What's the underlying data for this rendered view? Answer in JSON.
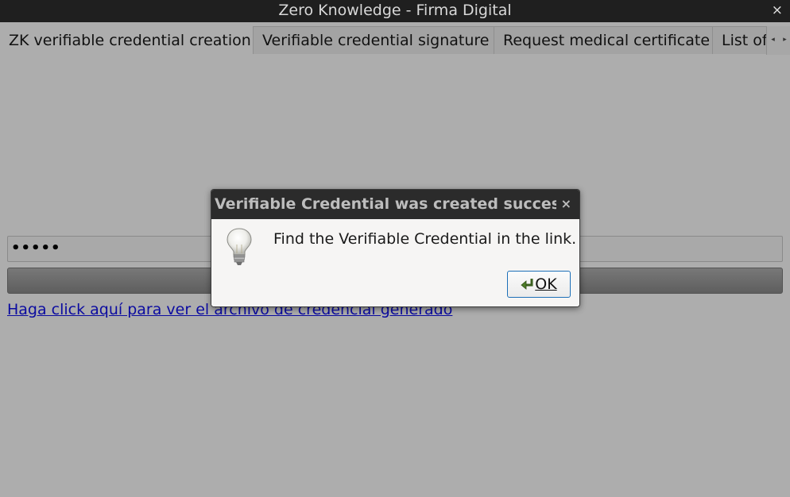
{
  "window": {
    "title": "Zero Knowledge - Firma Digital",
    "close_glyph": "×"
  },
  "tabs": [
    {
      "label": "ZK verifiable credential creation",
      "active": true
    },
    {
      "label": "Verifiable credential signature",
      "active": false
    },
    {
      "label": "Request medical certificate",
      "active": false
    },
    {
      "label": "List of",
      "active": false
    }
  ],
  "tab_scroll": {
    "left_icon": "◂",
    "right_icon": "▸"
  },
  "form": {
    "password_value": "•••••",
    "link_text": "Haga click aquí para ver el archivo de credencial generado",
    "link_color": "#0b0ba0"
  },
  "dialog": {
    "title": "Verifiable Credential was created succesfu…",
    "close_glyph": "×",
    "icon": "lightbulb-icon",
    "message": "Find the Verifiable Credential in the link.",
    "ok_label": "OK",
    "ok_icon": "apply-arrow-icon",
    "accent": "#1c6fb8"
  }
}
